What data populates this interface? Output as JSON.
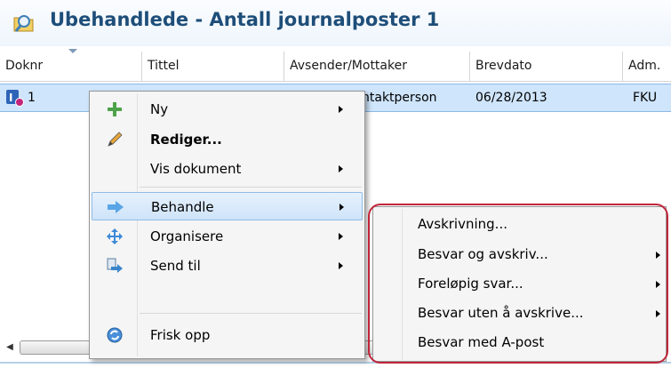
{
  "window": {
    "title": "Ubehandlede - Antall journalposter 1"
  },
  "table": {
    "columns": [
      "Doknr",
      "Tittel",
      "Avsender/Mottaker",
      "Brevdato",
      "Adm."
    ],
    "rows": [
      {
        "doknr": "1",
        "avsender": "ntaktperson",
        "brevdato": "06/28/2013",
        "adm": "FKU"
      }
    ]
  },
  "context_menu": {
    "items": [
      {
        "label": "Ny",
        "icon": "plus-icon",
        "submenu": true
      },
      {
        "label": "Rediger...",
        "icon": "pencil-icon",
        "bold": true
      },
      {
        "label": "Vis dokument",
        "submenu": true
      },
      {
        "label": "Behandle",
        "icon": "process-arrow-icon",
        "submenu": true,
        "highlighted": true
      },
      {
        "label": "Organisere",
        "icon": "move-icon",
        "submenu": true
      },
      {
        "label": "Send til",
        "icon": "send-icon",
        "submenu": true
      },
      {
        "label": "Frisk opp",
        "icon": "refresh-icon"
      }
    ]
  },
  "submenu_behandle": {
    "items": [
      {
        "label": "Avskrivning..."
      },
      {
        "label": "Besvar og avskriv...",
        "submenu": true
      },
      {
        "label": "Foreløpig svar...",
        "submenu": true
      },
      {
        "label": "Besvar uten å avskrive...",
        "submenu": true
      },
      {
        "label": "Besvar med A-post"
      }
    ]
  },
  "scrollbar": {
    "grip": "....."
  },
  "colors": {
    "title": "#1e4e79",
    "selection": "#cfe5fb",
    "highlight_outline": "#c0263a"
  }
}
